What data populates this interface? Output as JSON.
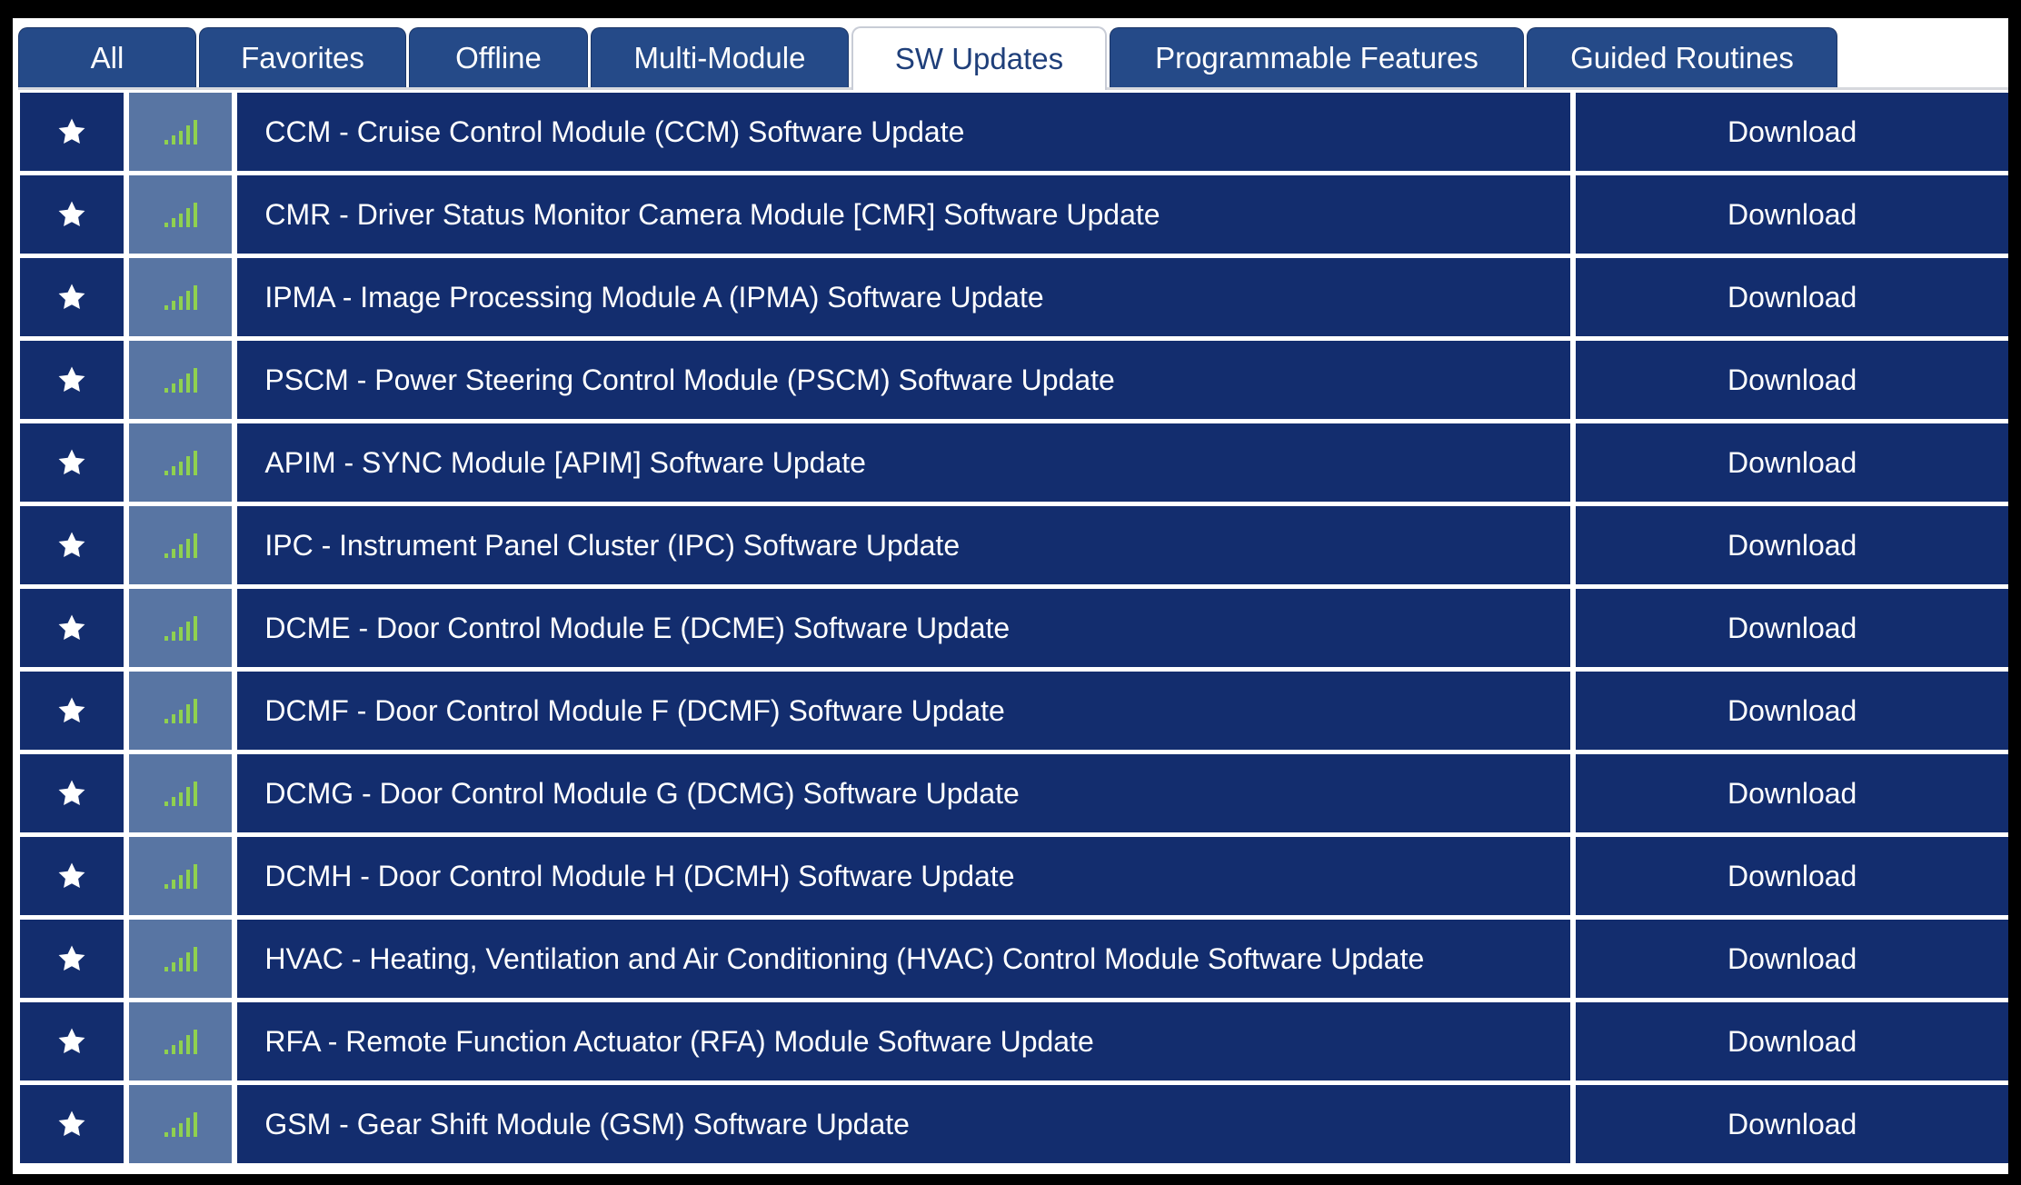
{
  "tabs": [
    {
      "label": "All",
      "active": false
    },
    {
      "label": "Favorites",
      "active": false
    },
    {
      "label": "Offline",
      "active": false
    },
    {
      "label": "Multi-Module",
      "active": false
    },
    {
      "label": "SW Updates",
      "active": true
    },
    {
      "label": "Programmable Features",
      "active": false
    },
    {
      "label": "Guided Routines",
      "active": false
    }
  ],
  "icons": {
    "favorite": "star-icon",
    "signal": "signal-strength-icon"
  },
  "colors": {
    "row_bg": "#132d6e",
    "signal_cell_bg": "#5875a3",
    "signal_bars": "#8fd14f",
    "tab_bg": "#254a88"
  },
  "rows": [
    {
      "name": "CCM - Cruise Control Module (CCM) Software Update",
      "action": "Download"
    },
    {
      "name": "CMR - Driver Status Monitor Camera Module [CMR] Software Update",
      "action": "Download"
    },
    {
      "name": "IPMA - Image Processing Module A (IPMA) Software Update",
      "action": "Download"
    },
    {
      "name": "PSCM - Power Steering Control Module (PSCM) Software Update",
      "action": "Download"
    },
    {
      "name": "APIM - SYNC Module [APIM] Software Update",
      "action": "Download"
    },
    {
      "name": "IPC - Instrument Panel Cluster (IPC) Software Update",
      "action": "Download"
    },
    {
      "name": "DCME - Door Control Module E (DCME) Software Update",
      "action": "Download"
    },
    {
      "name": "DCMF - Door Control Module F (DCMF) Software Update",
      "action": "Download"
    },
    {
      "name": "DCMG - Door Control Module G (DCMG) Software Update",
      "action": "Download"
    },
    {
      "name": "DCMH - Door Control Module H (DCMH) Software Update",
      "action": "Download"
    },
    {
      "name": "HVAC - Heating, Ventilation and Air Conditioning (HVAC) Control Module Software Update",
      "action": "Download"
    },
    {
      "name": "RFA - Remote Function Actuator (RFA) Module Software Update",
      "action": "Download"
    },
    {
      "name": "GSM - Gear Shift Module (GSM) Software Update",
      "action": "Download"
    }
  ]
}
